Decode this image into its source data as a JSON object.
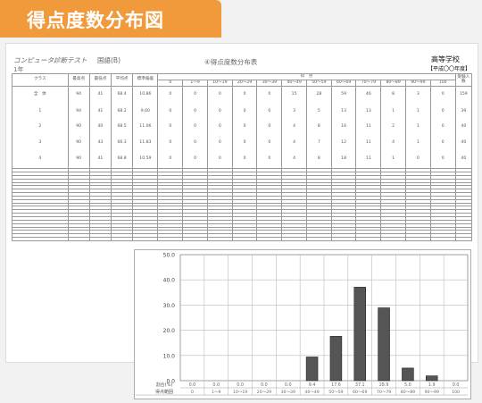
{
  "banner": {
    "title": "得点度数分布図"
  },
  "header": {
    "test_name": "コンピュータ診断テスト",
    "subject": "国語(B)",
    "doc_title": "④得点度数分布表",
    "grade": "1年",
    "school": "高等学校",
    "era": "【平成〇〇年度】"
  },
  "table": {
    "fixed_headers": [
      "クラス",
      "最高点",
      "最低点",
      "平均点",
      "標準偏差"
    ],
    "score_group_header": "得　点",
    "total_header": "受験人数",
    "bins": [
      "0",
      "1〜9",
      "10〜19",
      "20〜29",
      "30〜39",
      "40〜49",
      "50〜59",
      "60〜69",
      "70〜79",
      "80〜89",
      "90〜99",
      "100"
    ],
    "rows": [
      {
        "class": "全　体",
        "max": "94",
        "min": "41",
        "avg": "68.4",
        "sd": "10.86",
        "counts": [
          "0",
          "0",
          "0",
          "0",
          "0",
          "15",
          "28",
          "59",
          "46",
          "8",
          "3",
          "0"
        ],
        "total": "159"
      },
      {
        "class": "1",
        "max": "94",
        "min": "41",
        "avg": "68.2",
        "sd": "9.60",
        "counts": [
          "0",
          "0",
          "0",
          "0",
          "0",
          "3",
          "5",
          "13",
          "13",
          "1",
          "1",
          "0"
        ],
        "total": "39"
      },
      {
        "class": "2",
        "max": "90",
        "min": "40",
        "avg": "68.5",
        "sd": "11.06",
        "counts": [
          "0",
          "0",
          "0",
          "0",
          "0",
          "4",
          "8",
          "16",
          "11",
          "2",
          "1",
          "0"
        ],
        "total": "40"
      },
      {
        "class": "3",
        "max": "90",
        "min": "43",
        "avg": "66.3",
        "sd": "11.83",
        "counts": [
          "0",
          "0",
          "0",
          "0",
          "0",
          "4",
          "7",
          "12",
          "11",
          "4",
          "1",
          "0"
        ],
        "total": "40"
      },
      {
        "class": "4",
        "max": "90",
        "min": "41",
        "avg": "68.8",
        "sd": "10.59",
        "counts": [
          "0",
          "0",
          "0",
          "0",
          "0",
          "4",
          "8",
          "18",
          "11",
          "1",
          "0",
          "0"
        ],
        "total": "40"
      }
    ],
    "empty_rows": 21
  },
  "chart_data": {
    "type": "bar",
    "categories": [
      "0",
      "1〜9",
      "10〜19",
      "20〜29",
      "30〜39",
      "40〜49",
      "50〜59",
      "60〜69",
      "70〜79",
      "80〜89",
      "90〜99",
      "100"
    ],
    "values": [
      0.0,
      0.0,
      0.0,
      0.0,
      0.0,
      9.4,
      17.6,
      37.1,
      28.9,
      5.0,
      1.9,
      0.0
    ],
    "value_labels": [
      "0.0",
      "0.0",
      "0.0",
      "0.0",
      "0.0",
      "9.4",
      "17.6",
      "37.1",
      "28.9",
      "5.0",
      "1.9",
      "0.0"
    ],
    "yticks": [
      "50.0",
      "40.0",
      "30.0",
      "20.0",
      "10.0",
      "0.0"
    ],
    "ylim": [
      0,
      50
    ],
    "row_label_ratio": "割合(%)",
    "row_label_range": "得点範囲",
    "bar_color": "#555555"
  }
}
